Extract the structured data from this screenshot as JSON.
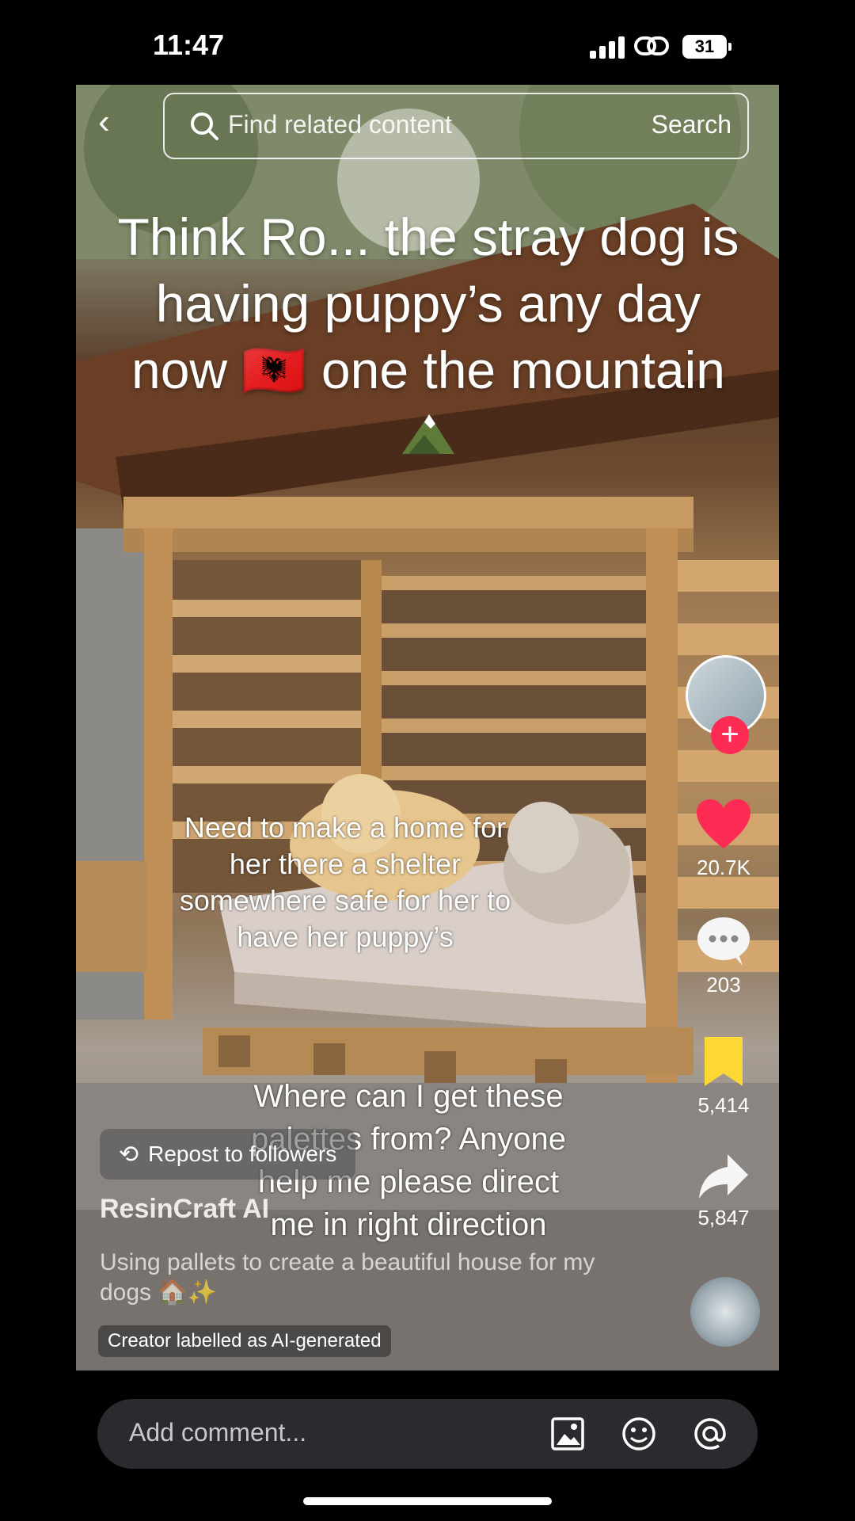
{
  "status": {
    "time": "11:47",
    "battery": "31"
  },
  "search": {
    "placeholder": "Find related content",
    "button": "Search"
  },
  "overlay": {
    "title_line1": "Think Ro... the stray dog is",
    "title_line2": "having puppy’s any day",
    "title_line3": "now 🇦🇱 one the mountain",
    "mid_text": "Need to make a home for her there a shelter somewhere safe for her to have her puppy’s",
    "bottom_text": "Where can I get these palettes from? Anyone help me please direct me in right direction"
  },
  "post": {
    "repost_label": "Repost to followers",
    "author": "ResinCraft AI",
    "caption": "Using pallets to create a beautiful house for my dogs 🏠✨",
    "ai_label": "Creator labelled as AI-generated"
  },
  "actions": {
    "likes": "20.7K",
    "comments": "203",
    "saves": "5,414",
    "shares": "5,847"
  },
  "comment_bar": {
    "placeholder": "Add comment..."
  },
  "colors": {
    "like": "#fe2c55",
    "bookmark": "#fdd835",
    "follow": "#fe2c55"
  },
  "icons": [
    "back-icon",
    "search-icon",
    "heart-icon",
    "comment-icon",
    "bookmark-icon",
    "share-icon",
    "image-icon",
    "emoji-icon",
    "at-icon"
  ]
}
